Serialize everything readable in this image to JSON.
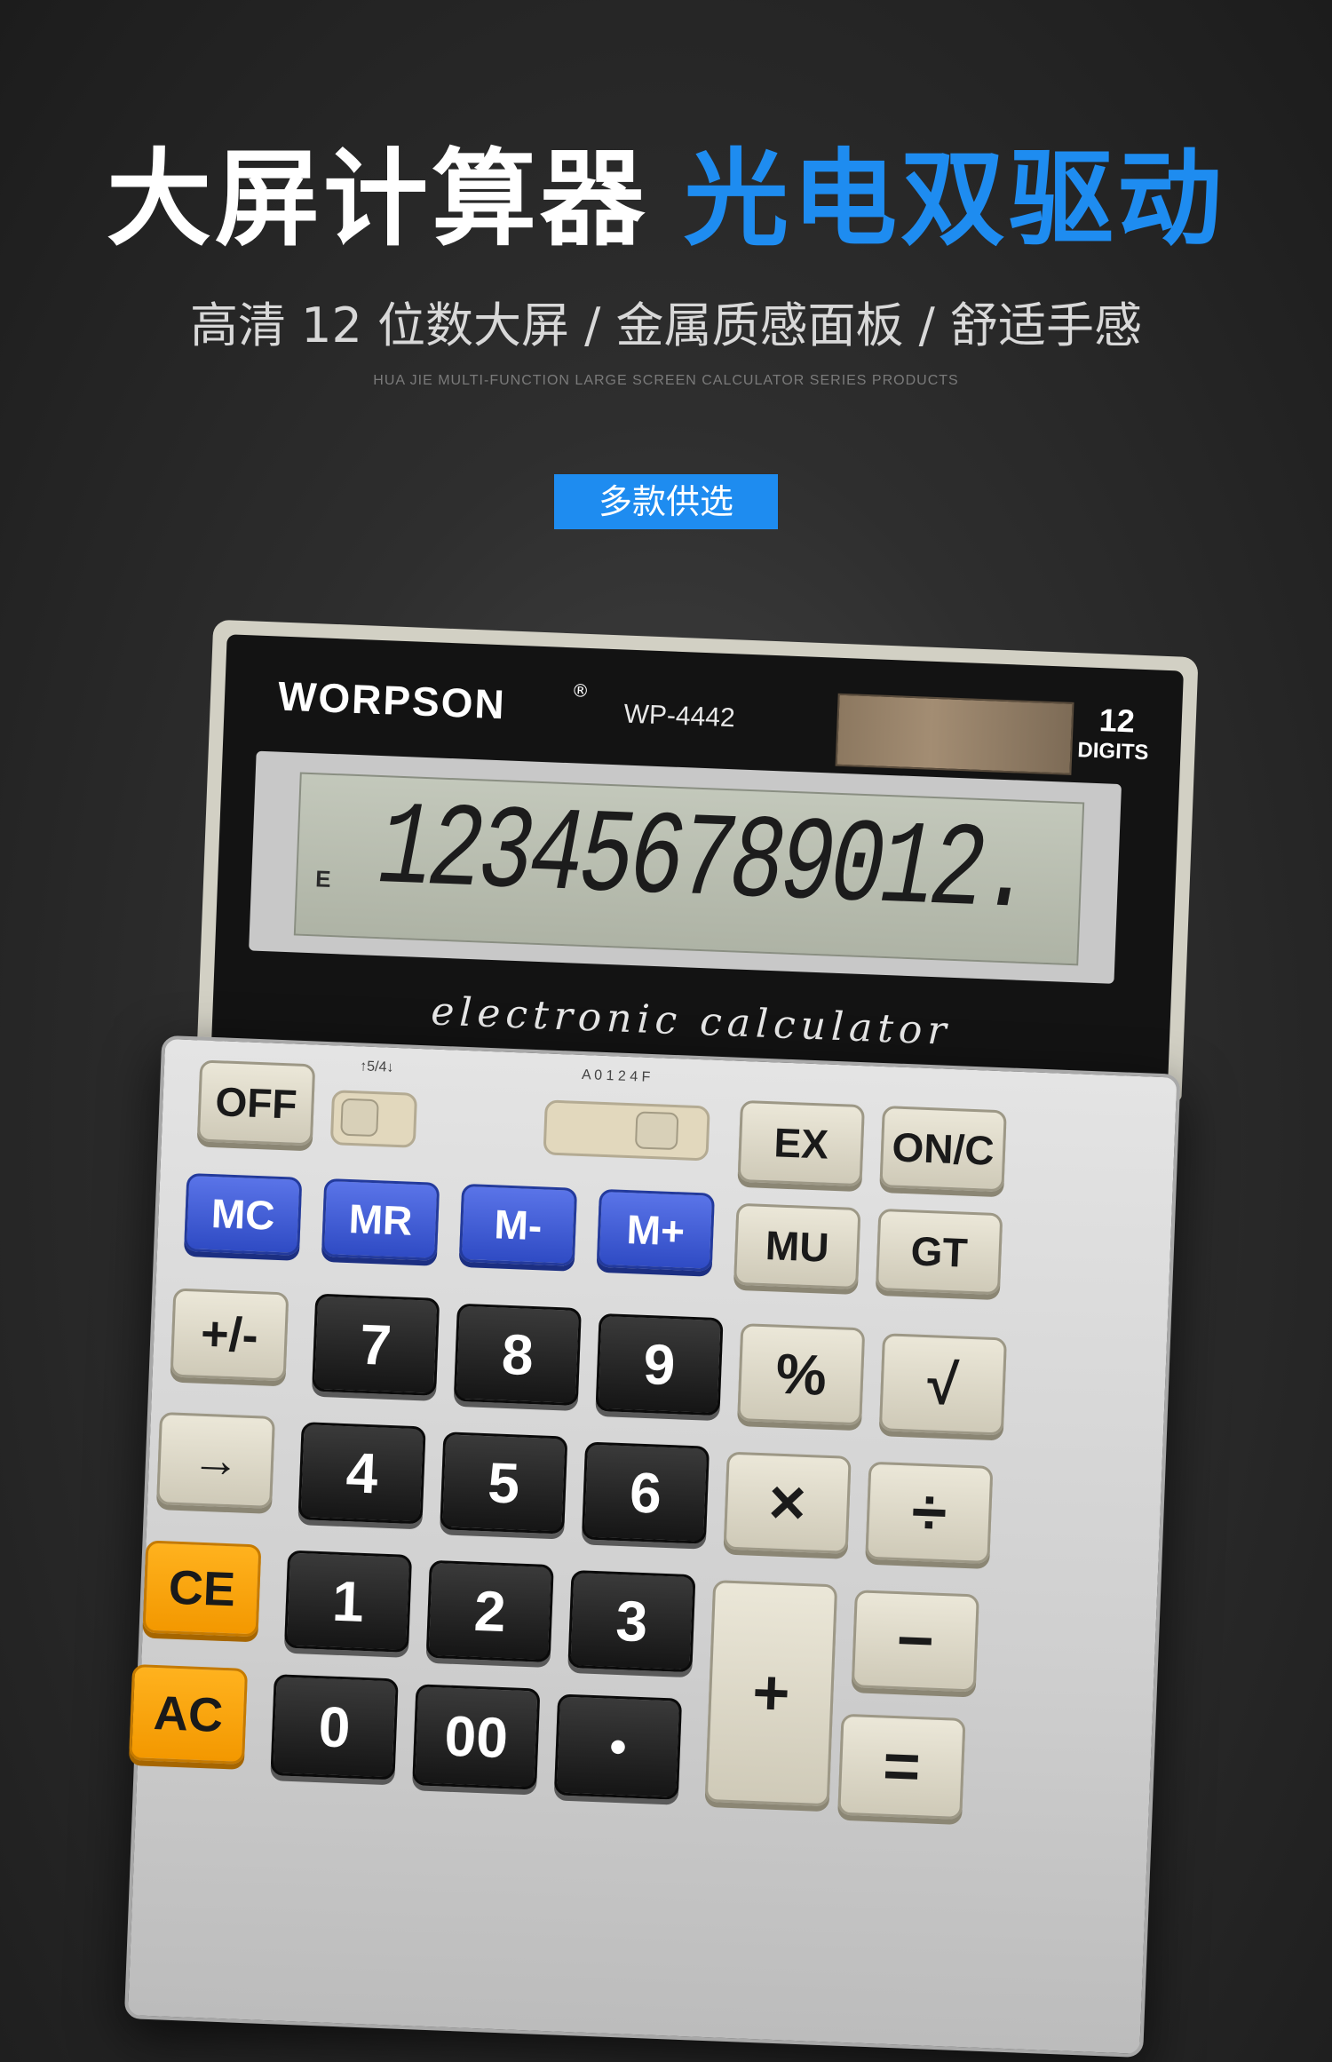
{
  "headline": {
    "white_text": "大屏计算器",
    "blue_text": "光电双驱动",
    "blue_color": "#1e8cf0"
  },
  "subtitle": "高清 12 位数大屏 / 金属质感面板 / 舒适手感",
  "english_tagline": "HUA JIE MULTI-FUNCTION LARGE SCREEN CALCULATOR SERIES PRODUCTS",
  "badge": "多款供选",
  "calculator": {
    "brand": "WORPSON",
    "registered_mark": "®",
    "model": "WP-4442",
    "digits_number": "12",
    "digits_label": "DIGITS",
    "display_indicator": "E",
    "display_value": "123456789012.",
    "tagline": "electronic calculator",
    "switch_round": "↑5/4↓",
    "switch_decimal": "A 0 1 2 4 F",
    "keys": {
      "off": "OFF",
      "ex": "EX",
      "on_c": "ON/C",
      "mc": "MC",
      "mr": "MR",
      "m_minus": "M-",
      "m_plus": "M+",
      "mu": "MU",
      "gt": "GT",
      "sign": "+/-",
      "seven": "7",
      "eight": "8",
      "nine": "9",
      "percent": "%",
      "sqrt": "√",
      "arrow": "→",
      "four": "4",
      "five": "5",
      "six": "6",
      "multiply": "×",
      "divide": "÷",
      "ce": "CE",
      "one": "1",
      "two": "2",
      "three": "3",
      "plus": "+",
      "minus": "−",
      "ac": "AC",
      "zero": "0",
      "double_zero": "00",
      "dot": "•",
      "equals": "="
    }
  }
}
